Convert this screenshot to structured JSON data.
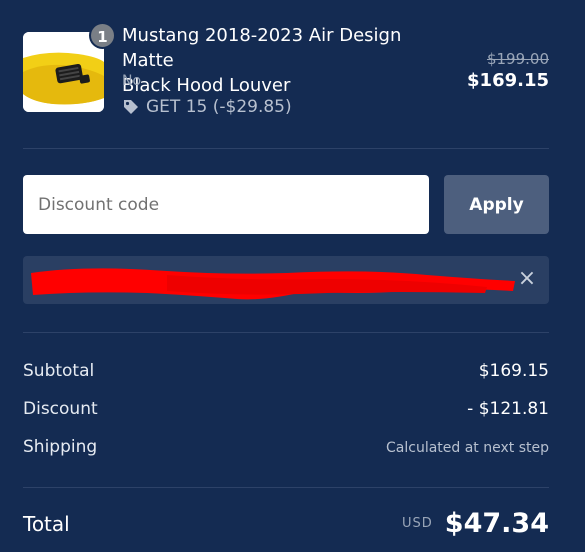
{
  "product": {
    "quantity": "1",
    "title_line1": "Mustang 2018-2023 Air Design Matte",
    "title_line2": "Black Hood Louver",
    "variant": "No",
    "discount_label": "GET 15 (-$29.85)",
    "price_original": "$199.00",
    "price_current": "$169.15",
    "image_icon": "hood-louver-image"
  },
  "discount": {
    "placeholder": "Discount code",
    "apply_label": "Apply",
    "remove_icon": "×"
  },
  "summary": {
    "subtotal_label": "Subtotal",
    "subtotal_value": "$169.15",
    "discount_label": "Discount",
    "discount_value": "- $121.81",
    "shipping_label": "Shipping",
    "shipping_value": "Calculated at next step"
  },
  "total": {
    "label": "Total",
    "currency": "USD",
    "value": "$47.34"
  },
  "colors": {
    "background": "#142b52",
    "apply_button": "#4d5f7e",
    "chip": "#2a3f63",
    "redaction": "#ff0000"
  }
}
